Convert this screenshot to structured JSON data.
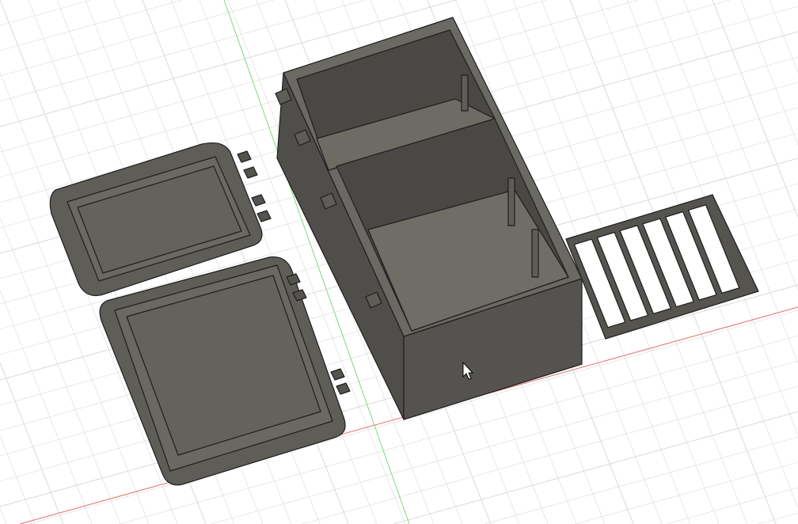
{
  "viewport": {
    "background": "#ffffff",
    "grid_color": "#d9d9d9",
    "axis_y_color": "#7ed87e",
    "axis_x_color": "#e07070"
  },
  "model": {
    "body_color": "#5a5853",
    "top_color": "#6b6964",
    "edge_color": "#1e1e1e",
    "interior_color": "#4a4844",
    "floor_color": "#6e6b65"
  }
}
